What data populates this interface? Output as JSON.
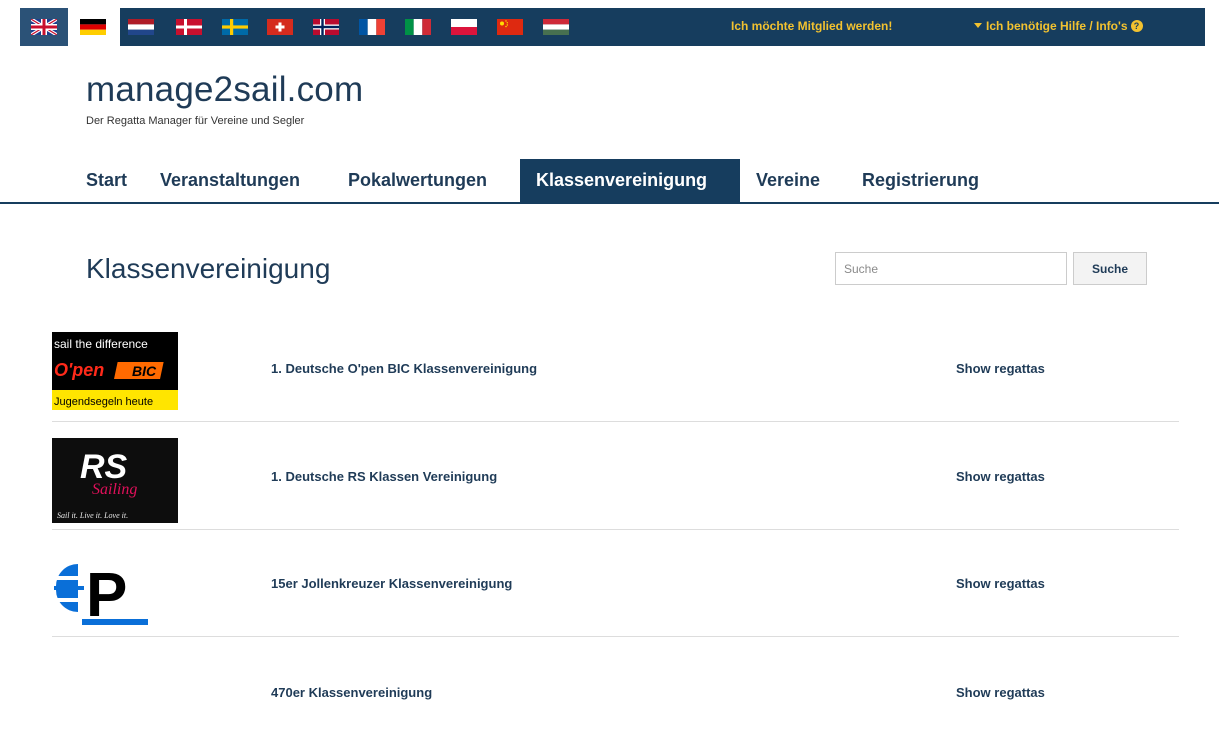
{
  "topbar": {
    "flags": [
      {
        "icon": "flag-uk-icon",
        "country": "uk"
      },
      {
        "icon": "flag-de-icon",
        "country": "de"
      },
      {
        "icon": "flag-nl-icon",
        "country": "nl"
      },
      {
        "icon": "flag-dk-icon",
        "country": "dk"
      },
      {
        "icon": "flag-se-icon",
        "country": "se"
      },
      {
        "icon": "flag-ch-icon",
        "country": "ch"
      },
      {
        "icon": "flag-no-icon",
        "country": "no"
      },
      {
        "icon": "flag-fr-icon",
        "country": "fr"
      },
      {
        "icon": "flag-it-icon",
        "country": "it"
      },
      {
        "icon": "flag-pl-icon",
        "country": "pl"
      },
      {
        "icon": "flag-cn-icon",
        "country": "cn"
      },
      {
        "icon": "flag-hu-icon",
        "country": "hu"
      }
    ],
    "member_link": "Ich möchte Mitglied werden!",
    "help_link": "Ich benötige Hilfe / Info's",
    "accent_color": "#f2c230",
    "bar_color": "#163d5e"
  },
  "brand": {
    "title": "manage2sail.com",
    "subtitle": "Der Regatta Manager für Vereine und Segler"
  },
  "nav": {
    "items": [
      {
        "label": "Start",
        "active": false
      },
      {
        "label": "Veranstaltungen",
        "active": false
      },
      {
        "label": "Pokalwertungen",
        "active": false
      },
      {
        "label": "Klassenvereinigung",
        "active": true
      },
      {
        "label": "Vereine",
        "active": false
      },
      {
        "label": "Registrierung",
        "active": false
      }
    ]
  },
  "main": {
    "title": "Klassenvereinigung",
    "search": {
      "placeholder": "Suche",
      "button_label": "Suche"
    },
    "rows": [
      {
        "name": "1. Deutsche O'pen BIC Klassenvereinigung",
        "action": "Show regattas",
        "logo": {
          "kind": "openbic",
          "line1": "sail the difference",
          "brand": "O'pen",
          "brand2": "BIC",
          "line3": "Jugendsegeln heute"
        }
      },
      {
        "name": "1. Deutsche RS Klassen Vereinigung",
        "action": "Show regattas",
        "logo": {
          "kind": "rs",
          "brand": "RS",
          "script": "Sailing",
          "tagline": "Sail it. Live it. Love it."
        }
      },
      {
        "name": "15er Jollenkreuzer Klassenvereinigung",
        "action": "Show regattas",
        "logo": {
          "kind": "p",
          "letter": "P"
        }
      },
      {
        "name": "470er Klassenvereinigung",
        "action": "Show regattas",
        "logo": {
          "kind": "none"
        }
      }
    ]
  }
}
